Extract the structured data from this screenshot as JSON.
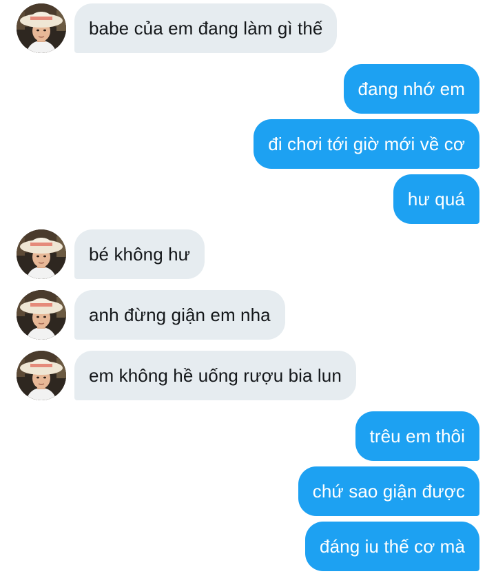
{
  "thread": {
    "messages": [
      {
        "from": "them",
        "text": "babe của em đang làm gì thế"
      },
      {
        "from": "me",
        "text": "đang nhớ em"
      },
      {
        "from": "me",
        "text": "đi chơi tới giờ mới về cơ"
      },
      {
        "from": "me",
        "text": "hư quá"
      },
      {
        "from": "them",
        "text": "bé không hư"
      },
      {
        "from": "them",
        "text": "anh đừng giận em nha"
      },
      {
        "from": "them",
        "text": "em không hề uống rượu bia lun"
      },
      {
        "from": "me",
        "text": "trêu em thôi"
      },
      {
        "from": "me",
        "text": "chứ sao giận được"
      },
      {
        "from": "me",
        "text": "đáng iu thế cơ mà"
      }
    ]
  },
  "colors": {
    "incoming_bubble": "#e6ecf0",
    "incoming_text": "#14171a",
    "outgoing_bubble": "#1da1f2",
    "outgoing_text": "#ffffff"
  },
  "icons": {
    "avatar": "contact-avatar-photo"
  }
}
